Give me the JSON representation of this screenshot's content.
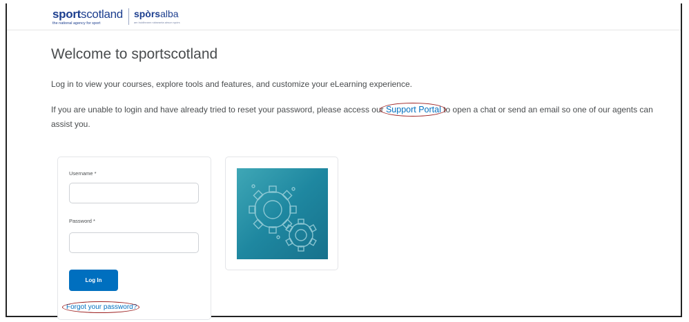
{
  "header": {
    "logo_sport_bold": "sport",
    "logo_sport_light": "scotland",
    "logo_tagline": "the national agency for sport",
    "logo_alba_bold": "spòrs",
    "logo_alba_light": "alba",
    "logo_alba_tagline": "am buidheann nàiseanta airson spòrs"
  },
  "main": {
    "title": "Welcome to sportscotland",
    "intro": "Log in to view your courses, explore tools and features, and customize your eLearning experience.",
    "help_before": "If you are unable to login and have already tried to reset your password, please access our ",
    "help_link": "Support Portal",
    "help_after": " to open a chat or send an email so one of our agents can assist you."
  },
  "login": {
    "username_label": "Username *",
    "username_value": "",
    "password_label": "Password *",
    "password_value": "",
    "login_button": "Log In",
    "forgot_link": "Forgot your password?"
  },
  "colors": {
    "brand_blue": "#1d3f8f",
    "link_blue": "#006fbf",
    "button_blue": "#006fbf",
    "annotation_red": "#9c1d1d",
    "tile_teal": "#1e87a0"
  },
  "icons": {
    "tile": "gears-icon"
  }
}
